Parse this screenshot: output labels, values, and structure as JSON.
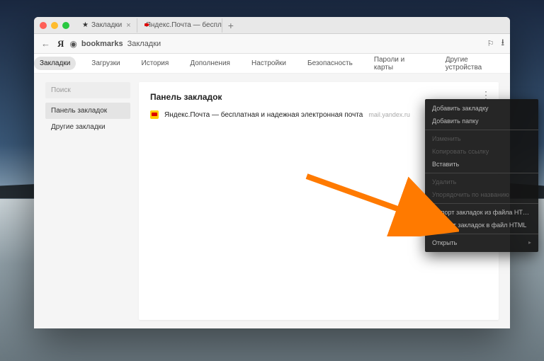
{
  "tabs": [
    {
      "label": "Закладки"
    },
    {
      "label": "Яндекс.Почта — беспл..."
    }
  ],
  "address": {
    "host": "bookmarks",
    "path": "Закладки"
  },
  "subnav": {
    "items": [
      "Закладки",
      "Загрузки",
      "История",
      "Дополнения",
      "Настройки",
      "Безопасность",
      "Пароли и карты",
      "Другие устройства"
    ]
  },
  "sidebar": {
    "search_placeholder": "Поиск",
    "items": [
      "Панель закладок",
      "Другие закладки"
    ]
  },
  "main": {
    "heading": "Панель закладок",
    "bookmarks": [
      {
        "title": "Яндекс.Почта — бесплатная и надежная электронная почта",
        "url": "mail.yandex.ru"
      }
    ]
  },
  "context_menu": {
    "items": [
      {
        "label": "Добавить закладку",
        "kind": "light"
      },
      {
        "label": "Добавить папку",
        "kind": "light"
      },
      {
        "sep": true
      },
      {
        "label": "Изменить",
        "kind": "dim"
      },
      {
        "label": "Копировать ссылку",
        "kind": "dim"
      },
      {
        "label": "Вставить",
        "kind": "light"
      },
      {
        "sep": true
      },
      {
        "label": "Удалить",
        "kind": "dim"
      },
      {
        "label": "Упорядочить по названию",
        "kind": "dim"
      },
      {
        "sep": true
      },
      {
        "label": "Импорт закладок из файла HTML",
        "kind": "light"
      },
      {
        "label": "Экспорт закладок в файл HTML",
        "kind": "light"
      },
      {
        "sep": true
      },
      {
        "label": "Открыть",
        "kind": "light",
        "sub": true
      }
    ]
  }
}
